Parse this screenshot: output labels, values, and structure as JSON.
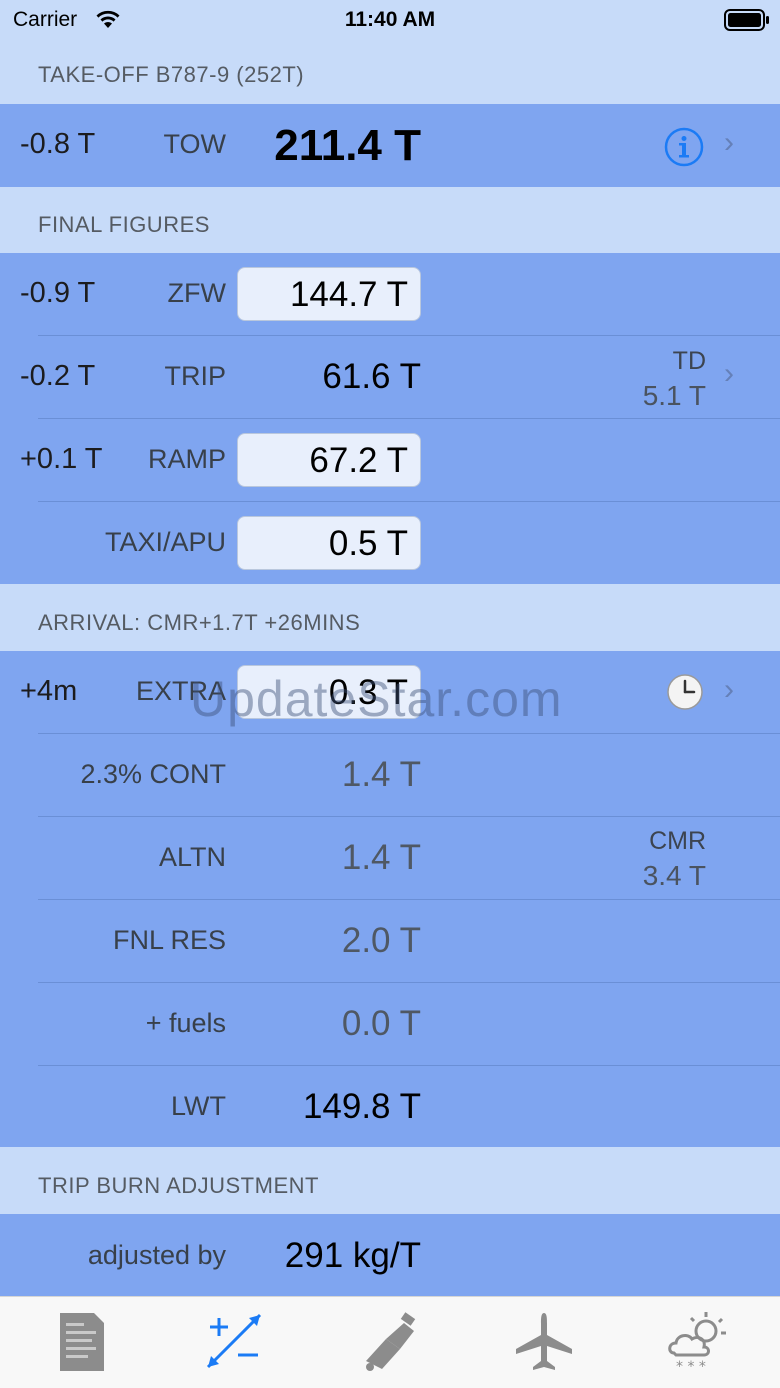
{
  "status_bar": {
    "carrier": "Carrier",
    "time": "11:40 AM"
  },
  "takeoff": {
    "header": "TAKE-OFF  B787-9 (252T)",
    "delta": "-0.8 T",
    "label": "TOW",
    "value": "211.4 T"
  },
  "final_figures": {
    "header": "FINAL FIGURES",
    "zfw": {
      "delta": "-0.9 T",
      "label": "ZFW",
      "value": "144.7 T"
    },
    "trip": {
      "delta": "-0.2 T",
      "label": "TRIP",
      "value": "61.6 T",
      "side_label": "TD",
      "side_value": "5.1 T"
    },
    "ramp": {
      "delta": "+0.1 T",
      "label": "RAMP",
      "value": "67.2 T"
    },
    "taxi": {
      "label": "TAXI/APU",
      "value": "0.5 T"
    }
  },
  "arrival": {
    "header": "ARRIVAL: CMR+1.7T  +26MINS",
    "extra": {
      "delta": "+4m",
      "label": "EXTRA",
      "value": "0.3 T"
    },
    "cont": {
      "label": "2.3% CONT",
      "value": "1.4 T"
    },
    "altn": {
      "label": "ALTN",
      "value": "1.4 T",
      "side_label": "CMR",
      "side_value": "3.4 T"
    },
    "fnl_res": {
      "label": "FNL RES",
      "value": "2.0 T"
    },
    "fuels": {
      "label": "+ fuels",
      "value": "0.0 T"
    },
    "lwt": {
      "label": "LWT",
      "value": "149.8 T"
    }
  },
  "trip_burn": {
    "header": "TRIP BURN ADJUSTMENT",
    "label": "adjusted by",
    "value": "291 kg/T"
  },
  "watermark": "UpdateStar.com",
  "tabs": [
    {
      "icon": "document-icon"
    },
    {
      "icon": "plus-minus-icon"
    },
    {
      "icon": "fuel-nozzle-icon"
    },
    {
      "icon": "airplane-icon"
    },
    {
      "icon": "weather-icon"
    }
  ],
  "colors": {
    "accent": "#1b7bf5",
    "row": "#7fa5f0",
    "header": "#c7dbf9"
  }
}
